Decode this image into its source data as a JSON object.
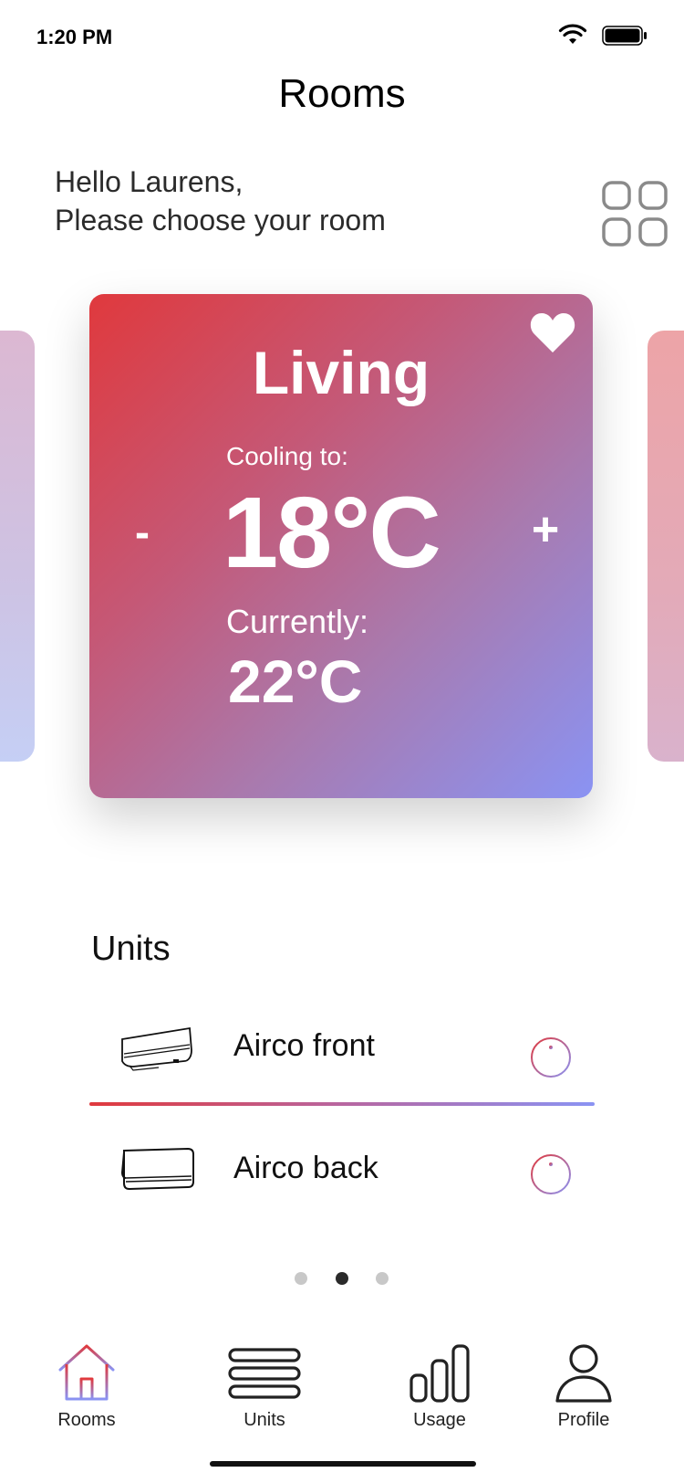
{
  "status_bar": {
    "time": "1:20 PM"
  },
  "header": {
    "title": "Rooms"
  },
  "greeting": {
    "line1": "Hello Laurens,",
    "line2": "Please choose your room"
  },
  "room_card": {
    "name": "Living",
    "cooling_label": "Cooling to:",
    "target_temp": "18°C",
    "current_label": "Currently:",
    "current_temp": "22°C",
    "minus_label": "-",
    "plus_label": "+",
    "favorited": true
  },
  "units": {
    "heading": "Units",
    "items": [
      {
        "name": "Airco front",
        "icon": "airco-unit-icon",
        "info_icon": "info-icon"
      },
      {
        "name": "Airco back",
        "icon": "airco-unit-icon",
        "info_icon": "info-icon"
      }
    ]
  },
  "pagination": {
    "count": 3,
    "active_index": 1
  },
  "tab_bar": {
    "items": [
      {
        "label": "Rooms",
        "icon": "house-icon",
        "active": true
      },
      {
        "label": "Units",
        "icon": "units-icon",
        "active": false
      },
      {
        "label": "Usage",
        "icon": "bar-chart-icon",
        "active": false
      },
      {
        "label": "Profile",
        "icon": "person-icon",
        "active": false
      }
    ]
  },
  "colors": {
    "gradient_start": "#e0393d",
    "gradient_end": "#8a93f3",
    "text": "#111111"
  }
}
